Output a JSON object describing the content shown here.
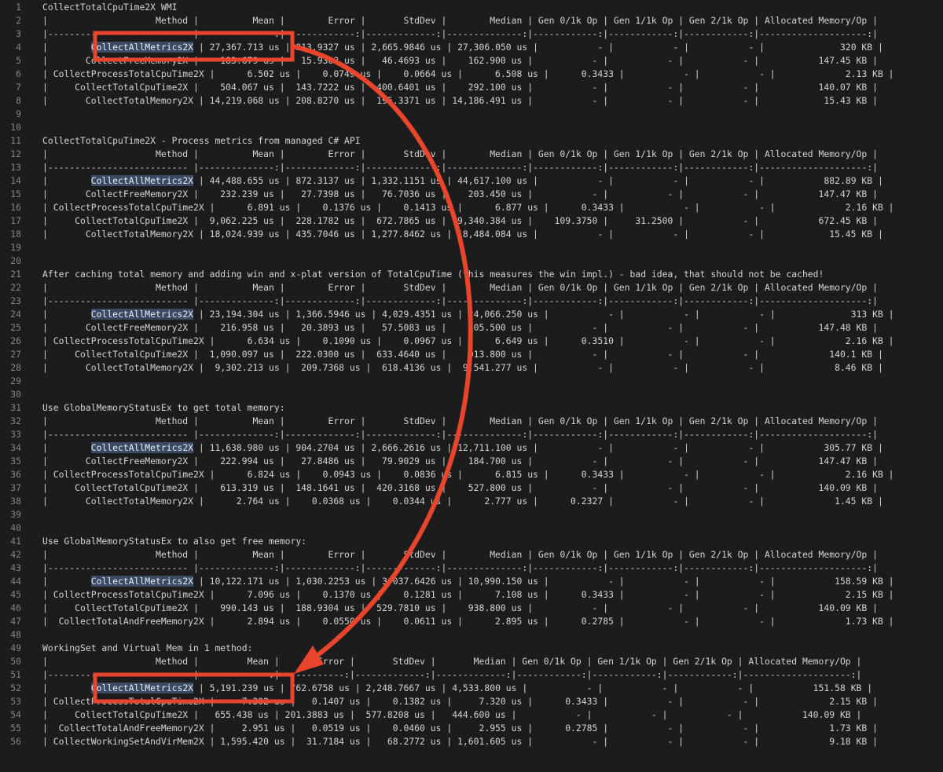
{
  "editor": {
    "lines": [
      {
        "n": "1",
        "t": "CollectTotalCpuTime2X WMI"
      },
      {
        "n": "2",
        "t": "|                    Method |          Mean |        Error |       StdDev |        Median | Gen 0/1k Op | Gen 1/1k Op | Gen 2/1k Op | Allocated Memory/Op |"
      },
      {
        "n": "3",
        "t": "|-------------------------- |--------------:|-------------:|-------------:|--------------:|------------:|------------:|------------:|--------------------:|"
      },
      {
        "n": "4",
        "t": "|        CollectAllMetrics2X | 27,367.713 us | 913.9327 us | 2,665.9846 us | 27,306.050 us |           - |           - |           - |              320 KB |",
        "hl": "CollectAllMetrics2X"
      },
      {
        "n": "5",
        "t": "|       CollectFreeMemory2X |    183.679 us |   15.9303 us |   46.4693 us |    162.900 us |           - |           - |           - |           147.45 KB |"
      },
      {
        "n": "6",
        "t": "| CollectProcessTotalCpuTime2X |      6.502 us |    0.0749 us |    0.0664 us |      6.508 us |      0.3433 |           - |           - |             2.13 KB |"
      },
      {
        "n": "7",
        "t": "|     CollectTotalCpuTime2X |    504.067 us |  143.7222 us |  400.6401 us |    292.100 us |           - |           - |           - |           140.07 KB |"
      },
      {
        "n": "8",
        "t": "|       CollectTotalMemory2X | 14,219.068 us | 208.8270 us |  195.3371 us | 14,186.491 us |           - |           - |           - |            15.43 KB |"
      },
      {
        "n": "9",
        "t": ""
      },
      {
        "n": "10",
        "t": ""
      },
      {
        "n": "11",
        "t": "CollectTotalCpuTime2X - Process metrics from managed C# API"
      },
      {
        "n": "12",
        "t": "|                    Method |          Mean |        Error |       StdDev |        Median | Gen 0/1k Op | Gen 1/1k Op | Gen 2/1k Op | Allocated Memory/Op |"
      },
      {
        "n": "13",
        "t": "|-------------------------- |--------------:|-------------:|-------------:|--------------:|------------:|------------:|------------:|--------------------:|"
      },
      {
        "n": "14",
        "t": "|        CollectAllMetrics2X | 44,488.655 us | 872.3137 us | 1,332.1151 us | 44,617.100 us |           - |           - |           - |           882.89 KB |",
        "hl": "CollectAllMetrics2X"
      },
      {
        "n": "15",
        "t": "|       CollectFreeMemory2X |    232.239 us |   27.7398 us |   76.7036 us |    203.450 us |           - |           - |           - |           147.47 KB |"
      },
      {
        "n": "16",
        "t": "| CollectProcessTotalCpuTime2X |      6.891 us |    0.1376 us |    0.1413 us |      6.877 us |      0.3433 |           - |           - |             2.16 KB |"
      },
      {
        "n": "17",
        "t": "|     CollectTotalCpuTime2X |  9,062.225 us |  228.1782 us |  672.7865 us |  9,340.384 us |    109.3750 |     31.2500 |           - |           672.45 KB |"
      },
      {
        "n": "18",
        "t": "|       CollectTotalMemory2X | 18,024.939 us | 435.7046 us | 1,277.8462 us | 18,484.084 us |           - |           - |           - |            15.45 KB |"
      },
      {
        "n": "19",
        "t": ""
      },
      {
        "n": "20",
        "t": ""
      },
      {
        "n": "21",
        "t": "After caching total memory and adding win and x-plat version of TotalCpuTime (this measures the win impl.) - bad idea, that should not be cached!"
      },
      {
        "n": "22",
        "t": "|                    Method |          Mean |        Error |       StdDev |        Median | Gen 0/1k Op | Gen 1/1k Op | Gen 2/1k Op | Allocated Memory/Op |"
      },
      {
        "n": "23",
        "t": "|-------------------------- |--------------:|-------------:|-------------:|--------------:|------------:|------------:|------------:|--------------------:|"
      },
      {
        "n": "24",
        "t": "|        CollectAllMetrics2X | 23,194.304 us | 1,366.5946 us | 4,029.4351 us | 24,066.250 us |           - |           - |           - |              313 KB |",
        "hl": "CollectAllMetrics2X"
      },
      {
        "n": "25",
        "t": "|       CollectFreeMemory2X |    216.958 us |   20.3893 us |   57.5083 us |    205.500 us |           - |           - |           - |           147.48 KB |"
      },
      {
        "n": "26",
        "t": "| CollectProcessTotalCpuTime2X |      6.634 us |    0.1090 us |    0.0967 us |      6.649 us |      0.3510 |           - |           - |             2.16 KB |"
      },
      {
        "n": "27",
        "t": "|     CollectTotalCpuTime2X |  1,090.097 us |  222.0300 us |  633.4640 us |    913.800 us |           - |           - |           - |             140.1 KB |"
      },
      {
        "n": "28",
        "t": "|       CollectTotalMemory2X |  9,302.213 us |  209.7368 us |  618.4136 us |  9,541.277 us |           - |           - |           - |             8.46 KB |"
      },
      {
        "n": "29",
        "t": ""
      },
      {
        "n": "30",
        "t": ""
      },
      {
        "n": "31",
        "t": "Use GlobalMemoryStatusEx to get total memory:"
      },
      {
        "n": "32",
        "t": "|                    Method |          Mean |        Error |       StdDev |        Median | Gen 0/1k Op | Gen 1/1k Op | Gen 2/1k Op | Allocated Memory/Op |"
      },
      {
        "n": "33",
        "t": "|-------------------------- |--------------:|-------------:|-------------:|--------------:|------------:|------------:|------------:|--------------------:|"
      },
      {
        "n": "34",
        "t": "|        CollectAllMetrics2X | 11,638.980 us | 904.2704 us | 2,666.2616 us | 12,711.100 us |           - |           - |           - |           305.77 KB |",
        "hl": "CollectAllMetrics2X"
      },
      {
        "n": "35",
        "t": "|       CollectFreeMemory2X |    222.994 us |   27.8486 us |   79.9029 us |    184.700 us |           - |           - |           - |           147.47 KB |"
      },
      {
        "n": "36",
        "t": "| CollectProcessTotalCpuTime2X |      6.824 us |    0.0943 us |    0.0836 us |      6.815 us |      0.3433 |           - |           - |             2.16 KB |"
      },
      {
        "n": "37",
        "t": "|     CollectTotalCpuTime2X |    613.319 us |  148.1641 us |  420.3168 us |    527.800 us |           - |           - |           - |           140.09 KB |"
      },
      {
        "n": "38",
        "t": "|       CollectTotalMemory2X |      2.764 us |    0.0368 us |    0.0344 us |      2.777 us |      0.2327 |           - |           - |             1.45 KB |"
      },
      {
        "n": "39",
        "t": ""
      },
      {
        "n": "40",
        "t": ""
      },
      {
        "n": "41",
        "t": "Use GlobalMemoryStatusEx to also get free memory:"
      },
      {
        "n": "42",
        "t": "|                    Method |          Mean |        Error |       StdDev |        Median | Gen 0/1k Op | Gen 1/1k Op | Gen 2/1k Op | Allocated Memory/Op |"
      },
      {
        "n": "43",
        "t": "|-------------------------- |--------------:|-------------:|-------------:|--------------:|------------:|------------:|------------:|--------------------:|"
      },
      {
        "n": "44",
        "t": "|        CollectAllMetrics2X | 10,122.171 us | 1,030.2253 us | 3,037.6426 us | 10,990.150 us |           - |           - |           - |           158.59 KB |",
        "hl": "CollectAllMetrics2X"
      },
      {
        "n": "45",
        "t": "| CollectProcessTotalCpuTime2X |      7.096 us |    0.1370 us |    0.1281 us |      7.108 us |      0.3433 |           - |           - |             2.15 KB |"
      },
      {
        "n": "46",
        "t": "|     CollectTotalCpuTime2X |    990.143 us |  188.9304 us |  529.7810 us |    938.800 us |           - |           - |           - |           140.09 KB |"
      },
      {
        "n": "47",
        "t": "|  CollectTotalAndFreeMemory2X |      2.894 us |    0.0550 us |    0.0611 us |      2.895 us |      0.2785 |           - |           - |             1.73 KB |"
      },
      {
        "n": "48",
        "t": ""
      },
      {
        "n": "49",
        "t": "WorkingSet and Virtual Mem in 1 method:"
      },
      {
        "n": "50",
        "t": "|                    Method |         Mean |       Error |       StdDev |       Median | Gen 0/1k Op | Gen 1/1k Op | Gen 2/1k Op | Allocated Memory/Op |"
      },
      {
        "n": "51",
        "t": "|-------------------------- |-------------:|------------:|-------------:|-------------:|------------:|------------:|------------:|--------------------:|"
      },
      {
        "n": "52",
        "t": "|        CollectAllMetrics2X | 5,191.239 us | 762.6758 us | 2,248.7667 us | 4,533.800 us |           - |           - |           - |           151.58 KB |",
        "hl": "CollectAllMetrics2X"
      },
      {
        "n": "53",
        "t": "| CollectProcessTotalCpuTime2X |     7.302 us |   0.1407 us |    0.1382 us |     7.320 us |      0.3433 |           - |           - |             2.15 KB |"
      },
      {
        "n": "54",
        "t": "|     CollectTotalCpuTime2X |   655.438 us | 201.3883 us |  577.8208 us |   444.600 us |           - |           - |           - |           140.09 KB |"
      },
      {
        "n": "55",
        "t": "|  CollectTotalAndFreeMemory2X |     2.951 us |   0.0519 us |    0.0460 us |     2.955 us |      0.2785 |           - |           - |             1.73 KB |"
      },
      {
        "n": "56",
        "t": "| CollectWorkingSetAndVirMem2X | 1,595.420 us |  31.7184 us |   68.2772 us | 1,601.605 us |           - |           - |           - |             9.18 KB |"
      }
    ]
  },
  "annotations": {
    "color": "#e8452c"
  }
}
